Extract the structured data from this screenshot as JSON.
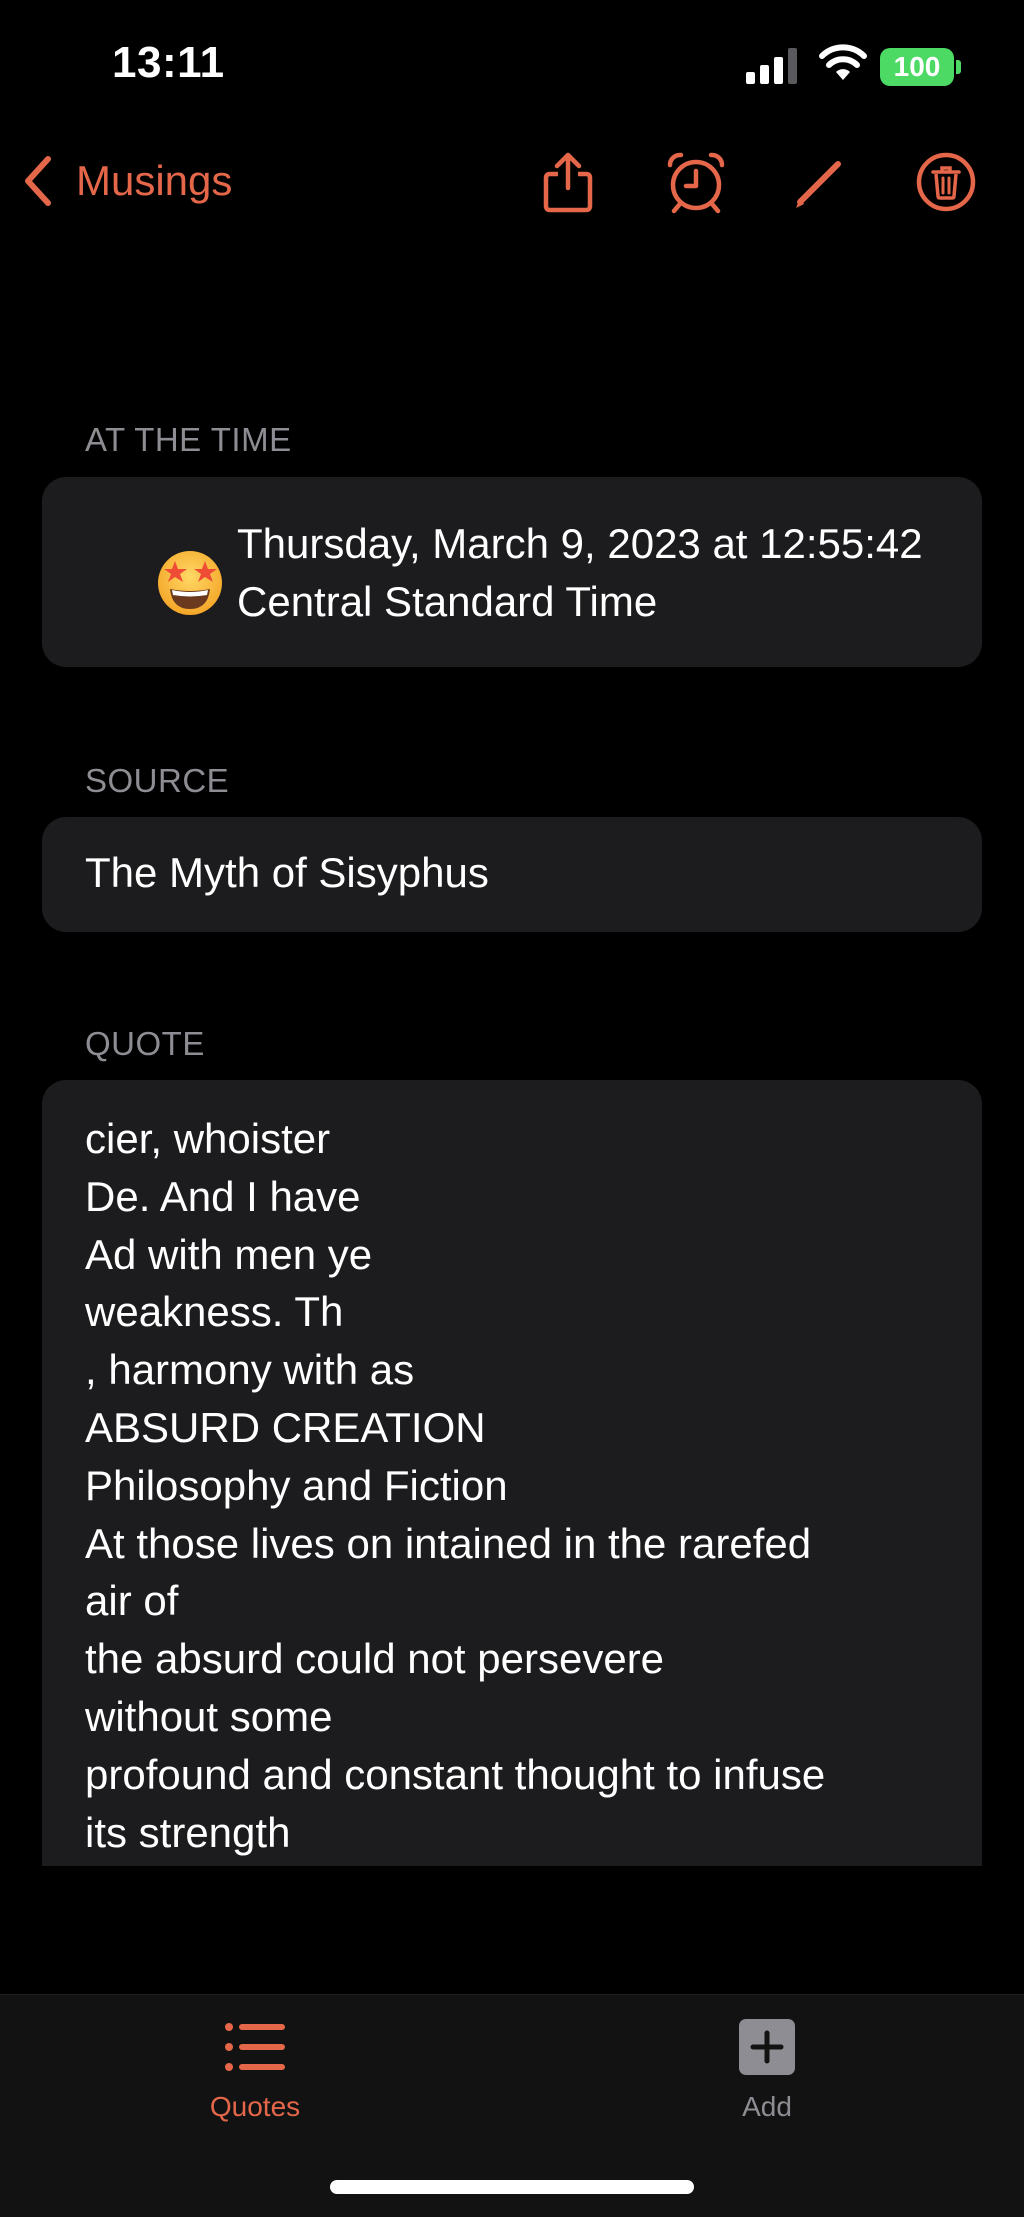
{
  "status_bar": {
    "time": "13:11",
    "battery": "100"
  },
  "nav": {
    "back_label": "Musings",
    "icons": [
      "share-icon",
      "alarm-icon",
      "edit-icon",
      "trash-icon"
    ]
  },
  "sections": {
    "time": {
      "label": "AT THE TIME",
      "timestamp": "Thursday, March 9, 2023 at 12:55:42 Central Standard Time",
      "emoji": "🤩"
    },
    "source": {
      "label": "SOURCE",
      "value": "The Myth of Sisyphus"
    },
    "quote": {
      "label": "QUOTE",
      "lines": [
        "cier, whoister",
        "De. And I have",
        "Ad with men ye",
        "weakness. Th",
        ", harmony with as",
        "ABSURD CREATION",
        "Philosophy and Fiction",
        "At those lives on intained in the rarefed",
        "air of",
        "the absurd could not persevere",
        "without some",
        "profound and constant thought to infuse",
        "its strength"
      ]
    }
  },
  "tab_bar": {
    "tabs": [
      {
        "label": "Quotes",
        "icon": "list-icon",
        "active": true
      },
      {
        "label": "Add",
        "icon": "plus-square-icon",
        "active": false
      }
    ]
  },
  "colors": {
    "accent": "#e4674a",
    "background": "#000000",
    "card": "#1c1c1e",
    "secondary_text": "#8d8d93",
    "battery": "#4cd964"
  }
}
